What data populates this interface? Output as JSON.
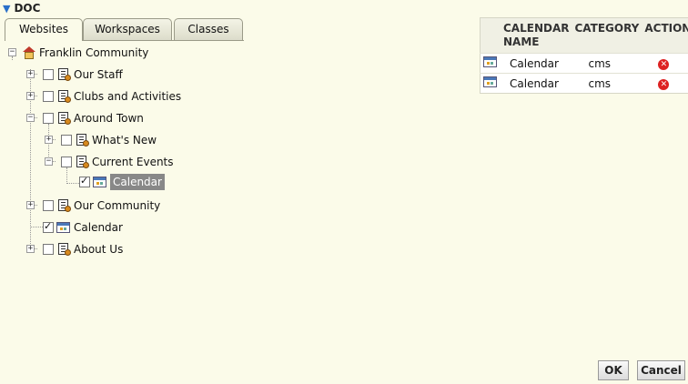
{
  "header": {
    "title": "DOC"
  },
  "tabs": [
    {
      "label": "Websites"
    },
    {
      "label": "Workspaces"
    },
    {
      "label": "Classes"
    }
  ],
  "tree": {
    "root": "Franklin Community",
    "items": [
      {
        "label": "Our Staff"
      },
      {
        "label": "Clubs and Activities"
      },
      {
        "label": "Around Town"
      },
      {
        "label": "What's New"
      },
      {
        "label": "Current Events"
      },
      {
        "label": "Calendar"
      },
      {
        "label": "Our Community"
      },
      {
        "label": "Calendar"
      },
      {
        "label": "About Us"
      }
    ]
  },
  "grid": {
    "headers": [
      "CALENDAR NAME",
      "CATEGORY",
      "ACTION"
    ],
    "rows": [
      {
        "name": "Calendar",
        "category": "cms"
      },
      {
        "name": "Calendar",
        "category": "cms"
      }
    ]
  },
  "buttons": {
    "ok": "OK",
    "cancel": "Cancel"
  },
  "colors": {
    "background": "#fbfbe9",
    "accent": "#2a6fc9",
    "selection": "#888888",
    "delete": "#dd2222"
  }
}
